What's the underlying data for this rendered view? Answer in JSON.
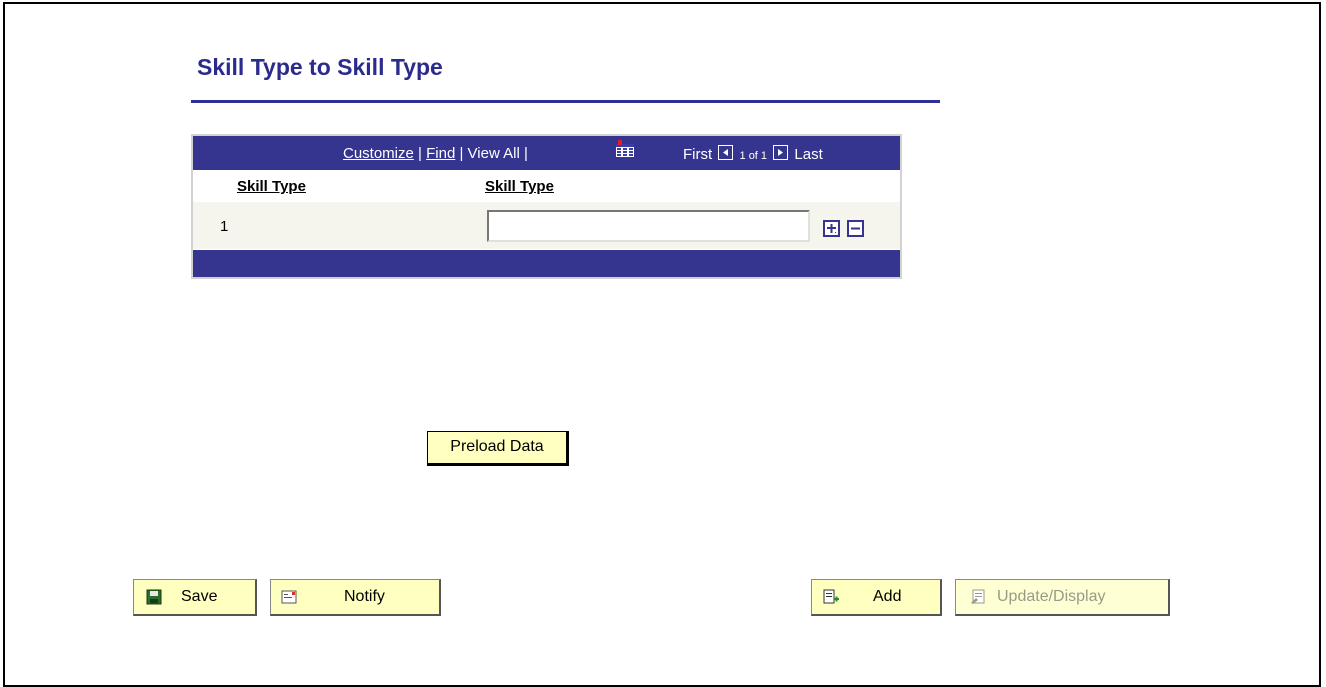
{
  "page": {
    "title": "Skill Type to Skill Type"
  },
  "grid": {
    "nav": {
      "customize": "Customize",
      "sep1": "|",
      "find": "Find",
      "sep2": "|",
      "view_all": "View All",
      "sep3": "|",
      "first": "First",
      "count": "1 of 1",
      "last": "Last"
    },
    "columns": [
      "Skill Type",
      "Skill Type"
    ],
    "rows": [
      {
        "num": "1",
        "value": ""
      }
    ]
  },
  "buttons": {
    "preload": "Preload Data",
    "save": "Save",
    "notify": "Notify",
    "add": "Add",
    "update_display": "Update/Display"
  },
  "colors": {
    "header_band": "#35358f",
    "title": "#2b2b8c",
    "button_bg": "#ffffc0"
  },
  "icons": {
    "grid_view": "grid-view-icon",
    "first": "left-arrow-icon",
    "last": "right-arrow-icon",
    "add_row": "plus-icon",
    "delete_row": "minus-icon",
    "save": "floppy-disk-icon",
    "notify": "envelope-icon",
    "add": "add-document-icon",
    "update_display": "update-display-icon"
  }
}
